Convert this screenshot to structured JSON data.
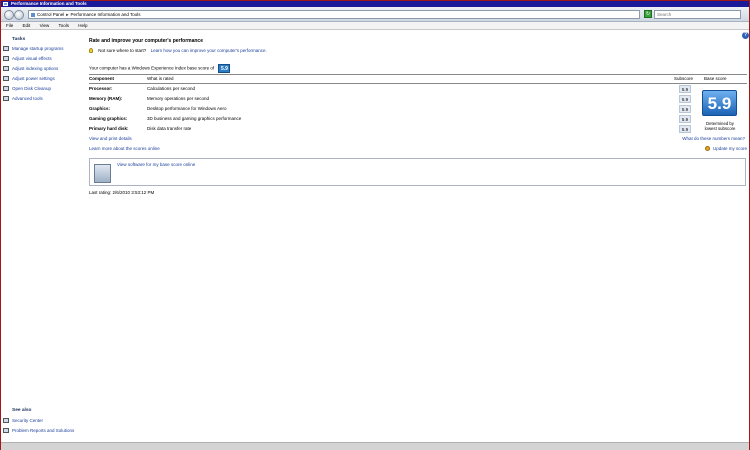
{
  "window": {
    "title": "Performance Information and Tools"
  },
  "navbar": {
    "breadcrumb": [
      "Control Panel",
      "Performance Information and Tools"
    ],
    "separator": "▸",
    "refresh_label": "↻",
    "search_placeholder": "Search"
  },
  "menu": {
    "items": [
      "File",
      "Edit",
      "View",
      "Tools",
      "Help"
    ]
  },
  "help_label": "?",
  "sidebar": {
    "tasks_heading": "Tasks",
    "tasks": [
      "Manage startup programs",
      "Adjust visual effects",
      "Adjust indexing options",
      "Adjust power settings",
      "Open Disk Cleanup",
      "Advanced tools"
    ],
    "see_also_heading": "See also",
    "see_also": [
      "Security Center",
      "Problem Reports and Solutions"
    ]
  },
  "main": {
    "heading": "Rate and improve your computer's performance",
    "tip_text": "Not sure where to start?",
    "tip_link": "Learn how you can improve your computer's performance.",
    "wei_text": "Your computer has a Windows Experience Index base score of",
    "wei_score": "5.9",
    "table": {
      "headers": [
        "Component",
        "What is rated",
        "Subscore",
        "Base score"
      ],
      "rows": [
        {
          "component": "Processor:",
          "rated": "Calculations per second",
          "subscore": "5.9"
        },
        {
          "component": "Memory (RAM):",
          "rated": "Memory operations per second",
          "subscore": "5.9"
        },
        {
          "component": "Graphics:",
          "rated": "Desktop performance for Windows Aero",
          "subscore": "5.9"
        },
        {
          "component": "Gaming graphics:",
          "rated": "3D business and gaming graphics performance",
          "subscore": "5.9"
        },
        {
          "component": "Primary hard disk:",
          "rated": "Disk data transfer rate",
          "subscore": "5.9"
        }
      ]
    },
    "base_score": "5.9",
    "base_caption": "Determined by lowest subscore",
    "view_details": "View and print details",
    "numbers_mean": "What do these numbers mean?",
    "learn_more": "Learn more about the scores online",
    "update_score": "Update my score",
    "software_link": "View software for my base score online",
    "last_rating": "Last rating: 2/6/2010 3:53:12 PM"
  },
  "colors": {
    "link": "#1b3e9a",
    "title_bar": "#1b1b9a",
    "score_badge": "#2b7cc6"
  }
}
